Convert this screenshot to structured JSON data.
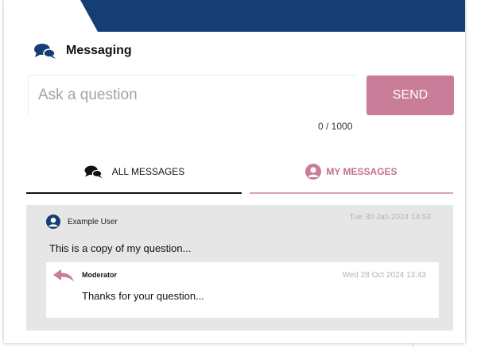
{
  "colors": {
    "brand_navy": "#163e75",
    "accent_pink": "#c97d98",
    "thread_bg": "#e6e6e6"
  },
  "header": {
    "title": "Messaging",
    "icon": "chat-bubbles-icon"
  },
  "composer": {
    "placeholder": "Ask a question",
    "value": "",
    "send_label": "SEND",
    "counter": "0 / 1000"
  },
  "tabs": [
    {
      "label": "ALL MESSAGES",
      "icon": "chat-bubbles-icon",
      "active": true
    },
    {
      "label": "MY MESSAGES",
      "icon": "user-avatar-icon",
      "active": false
    }
  ],
  "thread": {
    "author": "Example User",
    "author_icon": "user-avatar-icon",
    "timestamp": "Tue 30 Jan 2024 14:53",
    "text": "This is a copy of my question...",
    "reply": {
      "author": "Moderator",
      "icon": "reply-arrow-icon",
      "timestamp": "Wed 28 Oct 2024 13:43",
      "text": "Thanks for your question..."
    }
  }
}
